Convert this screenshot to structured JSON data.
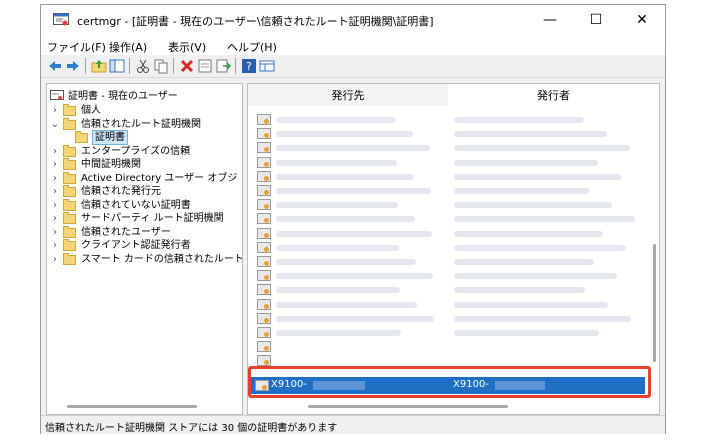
{
  "window": {
    "title": "certmgr - [証明書 - 現在のユーザー\\信頼されたルート証明機関\\証明書]",
    "minimize_glyph": "—",
    "maximize_glyph": "☐",
    "close_glyph": "✕"
  },
  "menu": [
    "ファイル(F)",
    "操作(A)",
    "表示(V)",
    "ヘルプ(H)"
  ],
  "toolbar_icons": [
    "back-icon",
    "forward-icon",
    "up-folder-icon",
    "show-hide-tree-icon",
    "cut-icon",
    "copy-icon",
    "delete-icon",
    "properties-icon",
    "export-icon",
    "help-icon",
    "view-icon"
  ],
  "tree": {
    "root": "証明書 - 現在のユーザー",
    "items": [
      {
        "label": "個人",
        "expander": "›",
        "indent": 1
      },
      {
        "label": "信頼されたルート証明機関",
        "expander": "⌄",
        "indent": 1
      },
      {
        "label": "証明書",
        "expander": "",
        "indent": 2,
        "selected": true
      },
      {
        "label": "エンタープライズの信頼",
        "expander": "›",
        "indent": 1
      },
      {
        "label": "中間証明機関",
        "expander": "›",
        "indent": 1
      },
      {
        "label": "Active Directory ユーザー オブジ",
        "expander": "›",
        "indent": 1
      },
      {
        "label": "信頼された発行元",
        "expander": "›",
        "indent": 1
      },
      {
        "label": "信頼されていない証明書",
        "expander": "›",
        "indent": 1
      },
      {
        "label": "サードパーティ ルート証明機関",
        "expander": "›",
        "indent": 1
      },
      {
        "label": "信頼されたユーザー",
        "expander": "›",
        "indent": 1
      },
      {
        "label": "クライアント認証発行者",
        "expander": "›",
        "indent": 1
      },
      {
        "label": "スマート カードの信頼されたルート",
        "expander": "›",
        "indent": 1
      }
    ]
  },
  "list": {
    "columns": [
      "発行先",
      "発行者"
    ],
    "selected_row": {
      "issued_to": "X9100-",
      "issued_by": "X9100-"
    }
  },
  "status": "信頼されたルート証明機関 ストアには 30 個の証明書があります",
  "colors": {
    "selection": "#1f6fc5",
    "highlight_box": "#e8402a"
  }
}
